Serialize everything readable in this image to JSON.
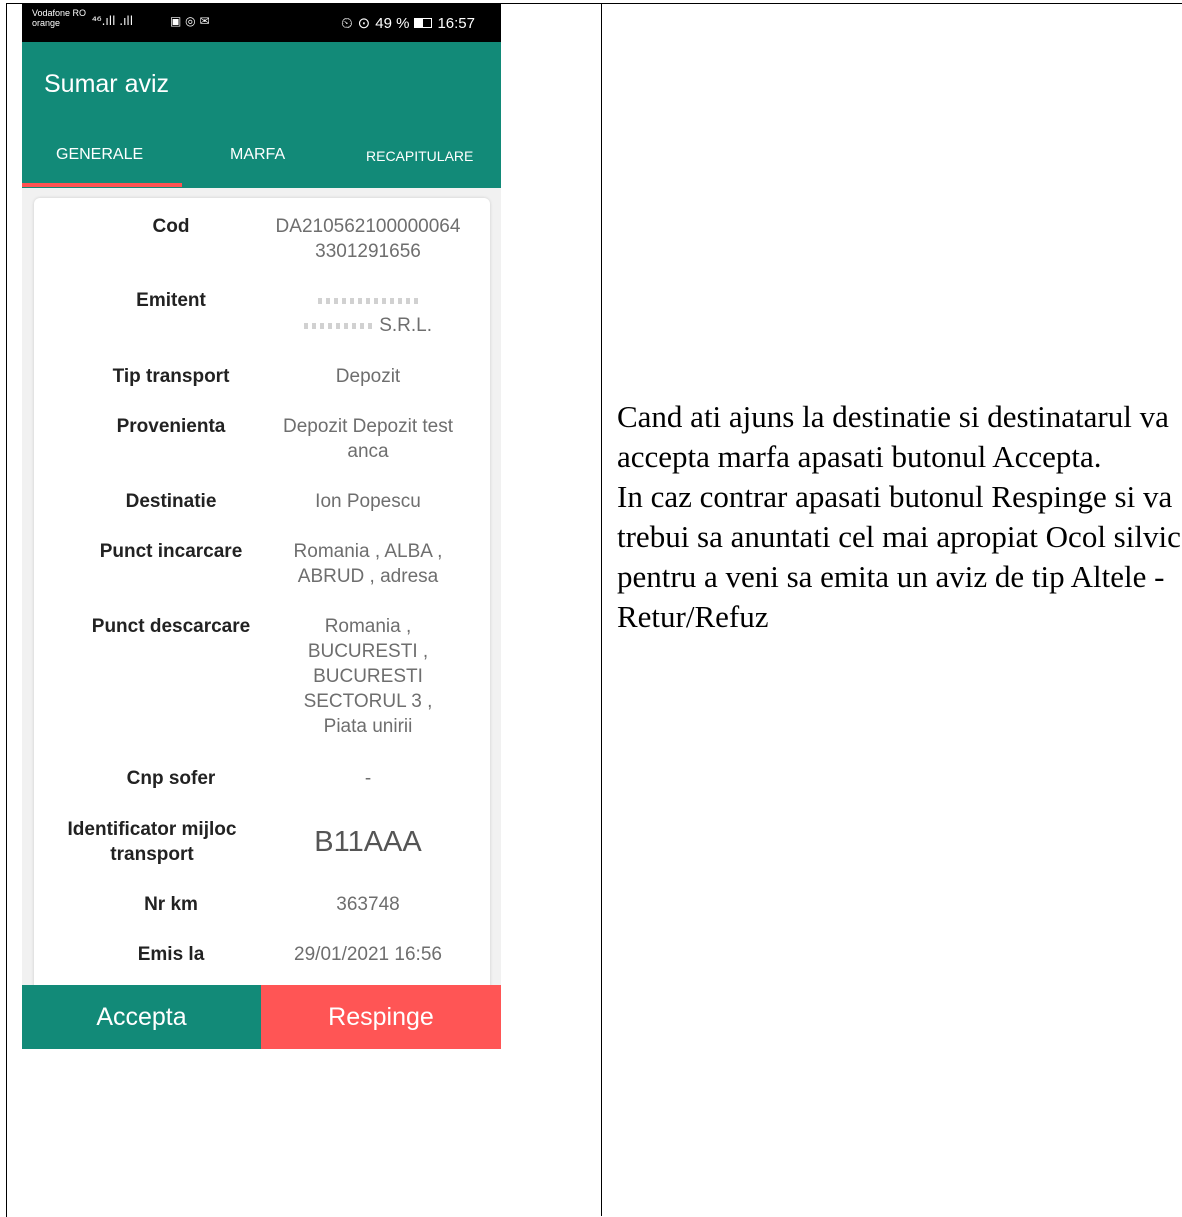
{
  "status_bar": {
    "carrier_line1": "Vodafone RO",
    "carrier_line2": "orange",
    "signal": "⁴⁶.ıll .ıll",
    "battery_percent": "49 %",
    "battery_level": 0.49,
    "time": "16:57"
  },
  "appbar": {
    "title": "Sumar aviz",
    "tabs": [
      {
        "label": "GENERALE",
        "active": true
      },
      {
        "label": "MARFA",
        "active": false
      },
      {
        "label": "RECAPITULARE",
        "active": false
      }
    ]
  },
  "details": {
    "cod": {
      "label": "Cod",
      "value": "DA210562100000064 3301291656"
    },
    "emitent": {
      "label": "Emitent",
      "value": "S.R.L."
    },
    "tip_transport": {
      "label": "Tip transport",
      "value": "Depozit"
    },
    "provenienta": {
      "label": "Provenienta",
      "value": "Depozit Depozit test anca"
    },
    "destinatie": {
      "label": "Destinatie",
      "value": "Ion Popescu"
    },
    "punct_incarcare": {
      "label": "Punct incarcare",
      "value": "Romania , ALBA , ABRUD , adresa"
    },
    "punct_descarcare": {
      "label": "Punct descarcare",
      "value": "Romania , BUCURESTI , BUCURESTI SECTORUL 3 , Piata unirii"
    },
    "cnp_sofer": {
      "label": "Cnp sofer",
      "value": "-"
    },
    "identificator": {
      "label": "Identificator mijloc transport",
      "value": "B11AAA"
    },
    "nr_km": {
      "label": "Nr km",
      "value": "363748"
    },
    "emis_la": {
      "label": "Emis la",
      "value": "29/01/2021 16:56"
    }
  },
  "actions": {
    "accept_label": "Accepta",
    "reject_label": "Respinge"
  },
  "instructions": {
    "paragraph1": "Cand ati ajuns la destinatie si destinatarul va accepta marfa apasati butonul Accepta.",
    "paragraph2": "In caz contrar apasati butonul Respinge si va trebui sa anuntati cel mai apropiat Ocol silvic pentru a veni sa emita un aviz de tip Altele - Retur/Refuz"
  },
  "colors": {
    "primary": "#128a78",
    "reject": "#ff5555",
    "tab_indicator": "#ff5252"
  }
}
